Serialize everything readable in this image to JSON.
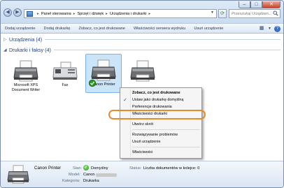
{
  "breadcrumb": [
    "Panel sterowania",
    "Sprzęt i dźwięk",
    "Urządzenia i drukarki"
  ],
  "search_placeholder": "Przeszukaj Urządzen...",
  "window_controls": {
    "minimize": "–",
    "maximize": "□",
    "close": "✕"
  },
  "toolbar": {
    "items": [
      "Dodaj urządzenie",
      "Dodaj drukarkę",
      "Zobacz, co jest drukowane",
      "Właściwości serwera wydruku",
      "Usuń urządzenie"
    ]
  },
  "groups": {
    "devices": "Urządzenia (4)",
    "printers": "Drukarki i faksy (4)"
  },
  "printers": [
    {
      "label_line1": "Microsoft XPS",
      "label_line2": "Document Writer",
      "icon": "printer-icon"
    },
    {
      "label_line1": "Fax",
      "label_line2": "",
      "icon": "fax-icon"
    },
    {
      "label_line1": "Canon Printer",
      "label_line2": "",
      "icon": "printer-icon",
      "selected": true,
      "default": true
    },
    {
      "label_line1": "",
      "label_line2": "",
      "icon": "printer-icon"
    }
  ],
  "context_menu": [
    "Zobacz, co jest drukowane",
    "Ustaw jako drukarkę domyślną",
    "Preferencje drukowania",
    "Właściwości drukarki",
    "Utwórz skrót",
    "Rozwiązywanie problemów",
    "Usuń urządzenie",
    "Właściwości"
  ],
  "details": {
    "name": "Canon Printer",
    "state_label": "Stan:",
    "state_value": "Domyślny",
    "model_label": "Model:",
    "model_value": "Canon",
    "category_label": "Kategoria:",
    "category_value": "Drukarka",
    "status_label": "Status:",
    "status_value": "Liczba dokumentów w kolejce: 0"
  },
  "colors": {
    "accent": "#1e3e8a",
    "highlight_ring": "#e88a2c",
    "selection": "#cce4f7"
  }
}
